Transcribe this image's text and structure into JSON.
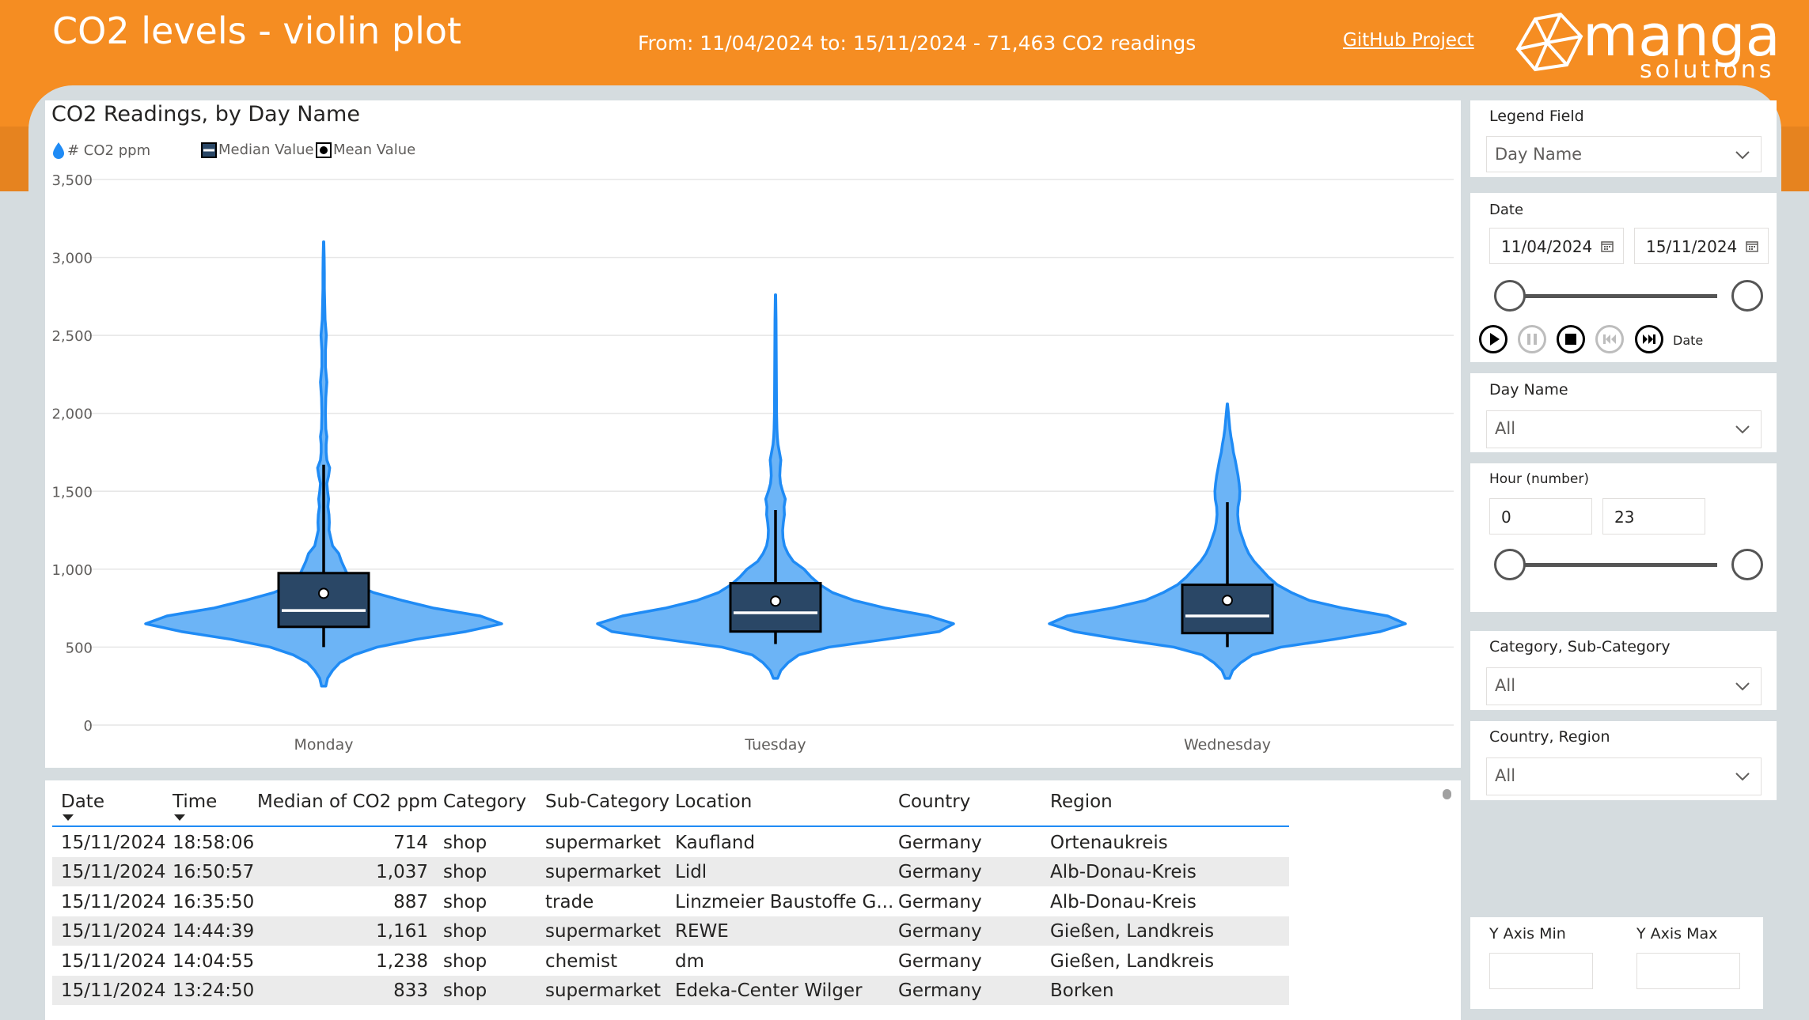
{
  "header": {
    "title": "CO2 levels - violin plot",
    "date_range": "From: 11/04/2024 to: 15/11/2024 - 71,463 CO2 readings",
    "github_link": "GitHub Project",
    "logo_text": "manga",
    "logo_subtext": "solutions",
    "accent_color": "#f58d22"
  },
  "chart": {
    "legend": {
      "series_label": "# CO2 ppm",
      "median_label": "Median Value",
      "mean_label": "Mean Value"
    }
  },
  "chart_data": {
    "type": "violin",
    "title": "CO2 Readings, by Day Name",
    "xlabel": "",
    "ylabel": "",
    "ylim": [
      0,
      3500
    ],
    "yticks": [
      0,
      500,
      1000,
      1500,
      2000,
      2500,
      3000,
      3500
    ],
    "ytick_labels": [
      "0",
      "500",
      "1,000",
      "1,500",
      "2,000",
      "2,500",
      "3,000",
      "3,500"
    ],
    "grid": true,
    "categories": [
      "Monday",
      "Tuesday",
      "Wednesday"
    ],
    "fill_color": "#6cb4f6",
    "stroke_color": "#1f8bf5",
    "box_color": "#2a4766",
    "series": [
      {
        "category": "Monday",
        "min": 250,
        "max": 3100,
        "whisker_low": 500,
        "whisker_high": 1670,
        "q1": 630,
        "median": 735,
        "q3": 975,
        "mean": 845,
        "density": [
          [
            250,
            0.012
          ],
          [
            300,
            0.022
          ],
          [
            350,
            0.05
          ],
          [
            400,
            0.09
          ],
          [
            450,
            0.17
          ],
          [
            500,
            0.3
          ],
          [
            550,
            0.52
          ],
          [
            600,
            0.8
          ],
          [
            650,
            1.0
          ],
          [
            700,
            0.88
          ],
          [
            750,
            0.62
          ],
          [
            800,
            0.44
          ],
          [
            850,
            0.28
          ],
          [
            900,
            0.18
          ],
          [
            950,
            0.14
          ],
          [
            1000,
            0.12
          ],
          [
            1050,
            0.1
          ],
          [
            1100,
            0.085
          ],
          [
            1150,
            0.05
          ],
          [
            1200,
            0.04
          ],
          [
            1250,
            0.03
          ],
          [
            1300,
            0.032
          ],
          [
            1350,
            0.03
          ],
          [
            1400,
            0.024
          ],
          [
            1450,
            0.028
          ],
          [
            1500,
            0.022
          ],
          [
            1550,
            0.018
          ],
          [
            1600,
            0.028
          ],
          [
            1650,
            0.034
          ],
          [
            1700,
            0.018
          ],
          [
            1750,
            0.014
          ],
          [
            1800,
            0.014
          ],
          [
            1850,
            0.018
          ],
          [
            1900,
            0.012
          ],
          [
            2000,
            0.01
          ],
          [
            2100,
            0.012
          ],
          [
            2200,
            0.018
          ],
          [
            2300,
            0.01
          ],
          [
            2400,
            0.01
          ],
          [
            2500,
            0.015
          ],
          [
            2600,
            0.008
          ],
          [
            2700,
            0.006
          ],
          [
            2800,
            0.004
          ],
          [
            2900,
            0.004
          ],
          [
            3000,
            0.003
          ],
          [
            3100,
            0.001
          ]
        ]
      },
      {
        "category": "Tuesday",
        "min": 300,
        "max": 2760,
        "whisker_low": 520,
        "whisker_high": 1380,
        "q1": 600,
        "median": 720,
        "q3": 910,
        "mean": 795,
        "density": [
          [
            300,
            0.012
          ],
          [
            350,
            0.03
          ],
          [
            400,
            0.07
          ],
          [
            450,
            0.13
          ],
          [
            500,
            0.3
          ],
          [
            550,
            0.62
          ],
          [
            600,
            0.92
          ],
          [
            650,
            1.0
          ],
          [
            700,
            0.86
          ],
          [
            750,
            0.62
          ],
          [
            800,
            0.44
          ],
          [
            850,
            0.32
          ],
          [
            900,
            0.25
          ],
          [
            950,
            0.2
          ],
          [
            1000,
            0.16
          ],
          [
            1050,
            0.1
          ],
          [
            1100,
            0.07
          ],
          [
            1150,
            0.05
          ],
          [
            1200,
            0.042
          ],
          [
            1250,
            0.04
          ],
          [
            1300,
            0.044
          ],
          [
            1350,
            0.05
          ],
          [
            1400,
            0.048
          ],
          [
            1450,
            0.055
          ],
          [
            1500,
            0.04
          ],
          [
            1550,
            0.028
          ],
          [
            1600,
            0.024
          ],
          [
            1650,
            0.026
          ],
          [
            1700,
            0.03
          ],
          [
            1750,
            0.022
          ],
          [
            1800,
            0.014
          ],
          [
            1850,
            0.01
          ],
          [
            1900,
            0.008
          ],
          [
            2000,
            0.006
          ],
          [
            2200,
            0.005
          ],
          [
            2400,
            0.004
          ],
          [
            2600,
            0.003
          ],
          [
            2760,
            0.001
          ]
        ]
      },
      {
        "category": "Wednesday",
        "min": 300,
        "max": 2060,
        "whisker_low": 500,
        "whisker_high": 1430,
        "q1": 590,
        "median": 700,
        "q3": 900,
        "mean": 800,
        "density": [
          [
            300,
            0.012
          ],
          [
            350,
            0.03
          ],
          [
            400,
            0.075
          ],
          [
            450,
            0.14
          ],
          [
            500,
            0.3
          ],
          [
            550,
            0.6
          ],
          [
            600,
            0.86
          ],
          [
            650,
            1.0
          ],
          [
            700,
            0.9
          ],
          [
            750,
            0.65
          ],
          [
            800,
            0.46
          ],
          [
            850,
            0.36
          ],
          [
            900,
            0.28
          ],
          [
            950,
            0.23
          ],
          [
            1000,
            0.19
          ],
          [
            1050,
            0.15
          ],
          [
            1100,
            0.12
          ],
          [
            1150,
            0.1
          ],
          [
            1200,
            0.085
          ],
          [
            1250,
            0.07
          ],
          [
            1300,
            0.062
          ],
          [
            1350,
            0.058
          ],
          [
            1400,
            0.06
          ],
          [
            1450,
            0.068
          ],
          [
            1500,
            0.07
          ],
          [
            1550,
            0.066
          ],
          [
            1600,
            0.06
          ],
          [
            1650,
            0.052
          ],
          [
            1700,
            0.044
          ],
          [
            1750,
            0.034
          ],
          [
            1800,
            0.028
          ],
          [
            1850,
            0.02
          ],
          [
            1900,
            0.014
          ],
          [
            1950,
            0.01
          ],
          [
            2000,
            0.006
          ],
          [
            2060,
            0.001
          ]
        ]
      }
    ]
  },
  "table": {
    "columns": [
      "Date",
      "Time",
      "Median of CO2 ppm",
      "Category",
      "Sub-Category",
      "Location",
      "Country",
      "Region"
    ],
    "rows": [
      [
        "15/11/2024",
        "18:58:06",
        "714",
        "shop",
        "supermarket",
        "Kaufland",
        "Germany",
        "Ortenaukreis"
      ],
      [
        "15/11/2024",
        "16:50:57",
        "1,037",
        "shop",
        "supermarket",
        "Lidl",
        "Germany",
        "Alb-Donau-Kreis"
      ],
      [
        "15/11/2024",
        "16:35:50",
        "887",
        "shop",
        "trade",
        "Linzmeier Baustoffe G...",
        "Germany",
        "Alb-Donau-Kreis"
      ],
      [
        "15/11/2024",
        "14:44:39",
        "1,161",
        "shop",
        "supermarket",
        "REWE",
        "Germany",
        "Gießen, Landkreis"
      ],
      [
        "15/11/2024",
        "14:04:55",
        "1,238",
        "shop",
        "chemist",
        "dm",
        "Germany",
        "Gießen, Landkreis"
      ],
      [
        "15/11/2024",
        "13:24:50",
        "833",
        "shop",
        "supermarket",
        "Edeka-Center Wilger",
        "Germany",
        "Borken"
      ]
    ]
  },
  "filters": {
    "legend_field": {
      "label": "Legend Field",
      "value": "Day Name"
    },
    "date": {
      "label": "Date",
      "start": "11/04/2024",
      "end": "15/11/2024",
      "play_label": "Date"
    },
    "day_name": {
      "label": "Day Name",
      "value": "All"
    },
    "hour": {
      "label": "Hour (number)",
      "min": "0",
      "max": "23"
    },
    "category": {
      "label": "Category, Sub-Category",
      "value": "All"
    },
    "country": {
      "label": "Country, Region",
      "value": "All"
    },
    "y_axis": {
      "min_label": "Y Axis Min",
      "max_label": "Y Axis Max",
      "min_value": "",
      "max_value": ""
    }
  }
}
